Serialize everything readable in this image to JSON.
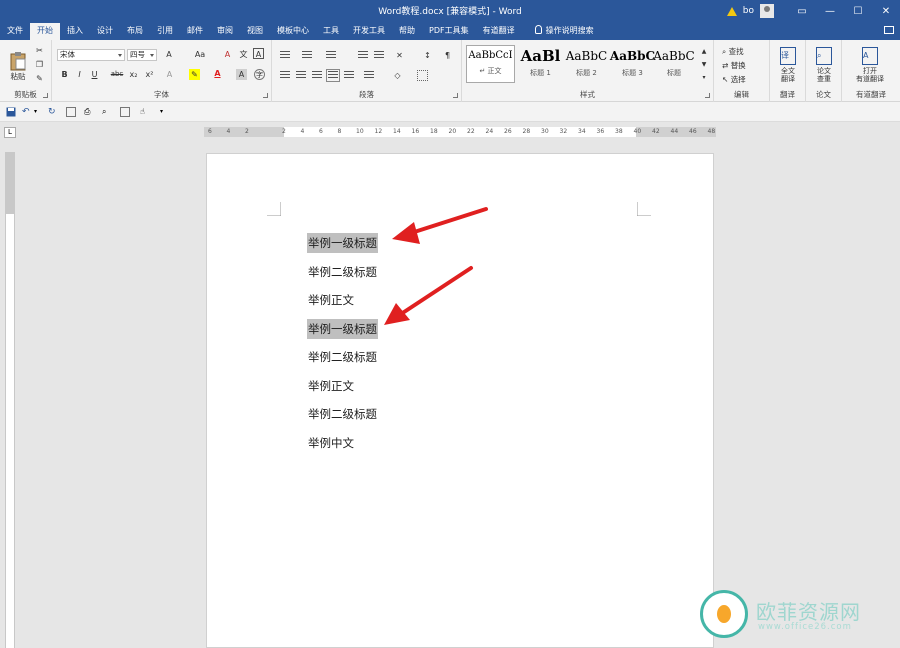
{
  "app": {
    "title": "Word教程.docx [兼容模式]  -  Word",
    "user": "bo",
    "window_controls": [
      "restore-ribbon-icon",
      "minimize-icon",
      "maximize-icon",
      "close-icon"
    ]
  },
  "tabs": [
    "文件",
    "开始",
    "插入",
    "设计",
    "布局",
    "引用",
    "邮件",
    "审阅",
    "视图",
    "模板中心",
    "工具",
    "开发工具",
    "帮助",
    "PDF工具集",
    "有道翻译"
  ],
  "tell_me": "操作说明搜索",
  "ribbon": {
    "clipboard": {
      "paste": "粘贴",
      "label": "剪贴板"
    },
    "font": {
      "font_name": "宋体",
      "font_size": "四号",
      "label": "字体",
      "bold": "B",
      "italic": "I",
      "underline": "U",
      "strike": "abc",
      "sub": "x₂",
      "sup": "x²",
      "grow": "A",
      "aa": "Aa",
      "font_color_glyph": "A"
    },
    "paragraph": {
      "label": "段落"
    },
    "styles": {
      "label": "样式",
      "items": [
        {
          "sample": "AaBbCcI",
          "name": "↵ 正文"
        },
        {
          "sample": "AaBl",
          "name": "标题 1"
        },
        {
          "sample": "AaBbC",
          "name": "标题 2"
        },
        {
          "sample": "AaBbC",
          "name": "标题 3"
        },
        {
          "sample": "AaBbC",
          "name": "标题"
        }
      ]
    },
    "editing": {
      "find": "查找",
      "replace": "替换",
      "select": "选择",
      "label": "编辑"
    },
    "translate": {
      "full": "全文\n翻译",
      "label": "翻译"
    },
    "paper": {
      "check": "论文\n查重",
      "label": "论文"
    },
    "youdao": {
      "open": "打开\n有道翻译",
      "label": "有道翻译"
    }
  },
  "ruler": {
    "ticks": [
      "6",
      "4",
      "2",
      "",
      "2",
      "4",
      "6",
      "8",
      "10",
      "12",
      "14",
      "16",
      "18",
      "20",
      "22",
      "24",
      "26",
      "28",
      "30",
      "32",
      "34",
      "36",
      "38",
      "40",
      "42",
      "44",
      "46",
      "48"
    ]
  },
  "document": {
    "paragraphs": [
      {
        "text": "举例一级标题",
        "highlight": true
      },
      {
        "text": "举例二级标题",
        "highlight": false
      },
      {
        "text": "举例正文",
        "highlight": false
      },
      {
        "text": "举例一级标题",
        "highlight": true
      },
      {
        "text": "举例二级标题",
        "highlight": false
      },
      {
        "text": "举例正文",
        "highlight": false
      },
      {
        "text": "举例二级标题",
        "highlight": false
      },
      {
        "text": "举例中文",
        "highlight": false
      }
    ]
  },
  "colors": {
    "ribbon_blue": "#2b579a",
    "highlight": "#bfbfbf",
    "arrow": "#e02020",
    "font_color": "#e02020",
    "highlighter": "#ffff00"
  },
  "watermark": {
    "name": "欧菲资源网",
    "url": "www.office26.com"
  }
}
